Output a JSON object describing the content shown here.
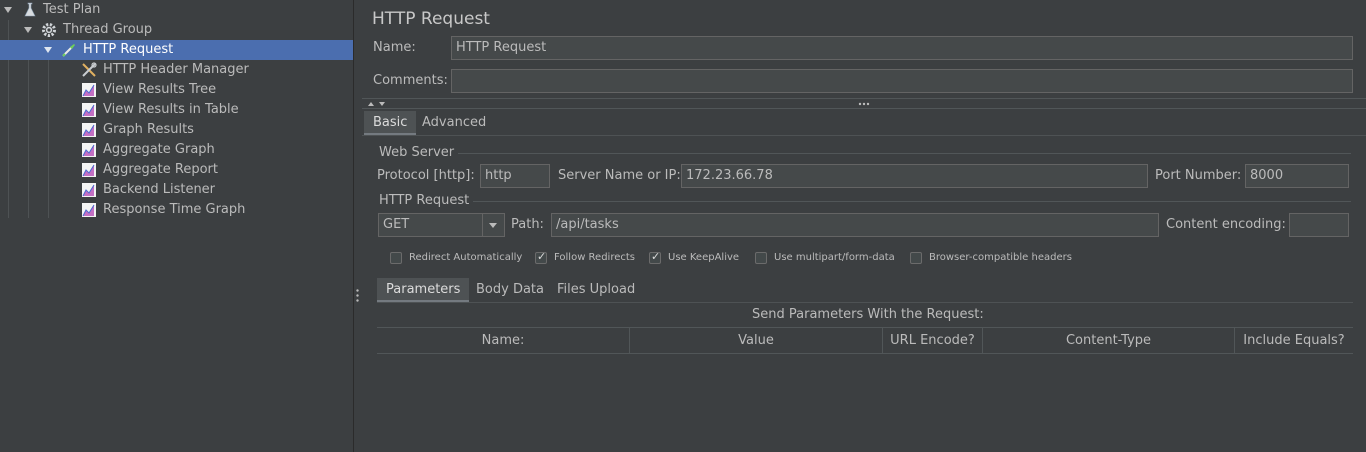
{
  "tree": {
    "items": [
      {
        "label": "Test Plan",
        "icon": "flask-icon"
      },
      {
        "label": "Thread Group",
        "icon": "gear-icon"
      },
      {
        "label": "HTTP Request",
        "icon": "pipette-icon"
      },
      {
        "label": "HTTP Header Manager",
        "icon": "wrench-icon"
      },
      {
        "label": "View Results Tree",
        "icon": "graph-icon"
      },
      {
        "label": "View Results in Table",
        "icon": "graph-icon"
      },
      {
        "label": "Graph Results",
        "icon": "graph-icon"
      },
      {
        "label": "Aggregate Graph",
        "icon": "graph-icon"
      },
      {
        "label": "Aggregate Report",
        "icon": "graph-icon"
      },
      {
        "label": "Backend Listener",
        "icon": "graph-icon"
      },
      {
        "label": "Response Time Graph",
        "icon": "graph-icon"
      }
    ]
  },
  "panel": {
    "title": "HTTP Request",
    "name_label": "Name:",
    "name_value": "HTTP Request",
    "comments_label": "Comments:",
    "comments_value": ""
  },
  "tabs": {
    "basic": "Basic",
    "advanced": "Advanced"
  },
  "web_server": {
    "legend": "Web Server",
    "protocol_label": "Protocol [http]:",
    "protocol_value": "http",
    "server_label": "Server Name or IP:",
    "server_value": "172.23.66.78",
    "port_label": "Port Number:",
    "port_value": "8000"
  },
  "http_request": {
    "legend": "HTTP Request",
    "method": "GET",
    "path_label": "Path:",
    "path_value": "/api/tasks",
    "encoding_label": "Content encoding:",
    "encoding_value": ""
  },
  "options": [
    {
      "label": "Redirect Automatically",
      "checked": false
    },
    {
      "label": "Follow Redirects",
      "checked": true
    },
    {
      "label": "Use KeepAlive",
      "checked": true
    },
    {
      "label": "Use multipart/form-data",
      "checked": false
    },
    {
      "label": "Browser-compatible headers",
      "checked": false
    }
  ],
  "sub_tabs": {
    "parameters": "Parameters",
    "body_data": "Body Data",
    "files_upload": "Files Upload"
  },
  "params": {
    "caption": "Send Parameters With the Request:",
    "columns": [
      "Name:",
      "Value",
      "URL Encode?",
      "Content-Type",
      "Include Equals?"
    ]
  }
}
